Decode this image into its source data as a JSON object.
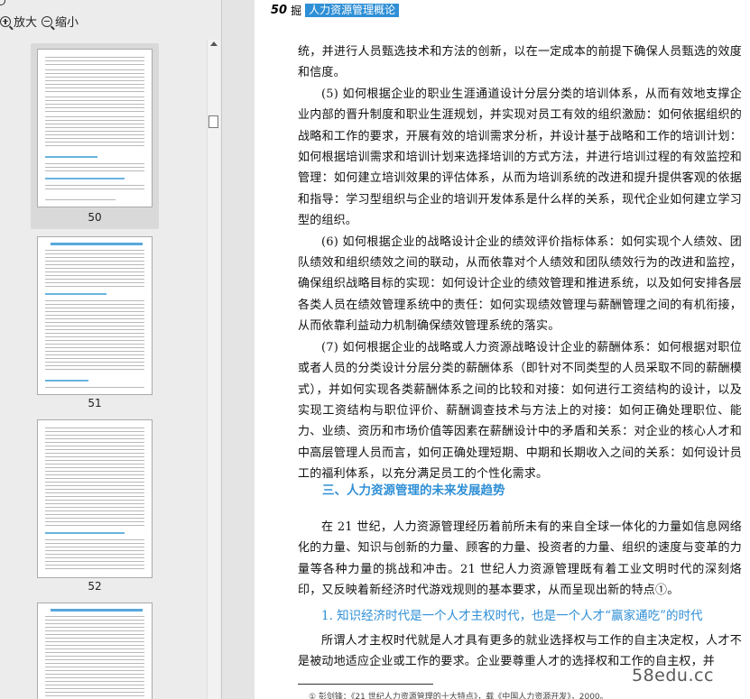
{
  "toolbar": {
    "zoom_in_label": "放大",
    "zoom_out_label": "缩小"
  },
  "thumbnails": [
    {
      "page_number": "50",
      "active": true
    },
    {
      "page_number": "51",
      "active": false
    },
    {
      "page_number": "52",
      "active": false
    }
  ],
  "page": {
    "page_number": "50",
    "header_mark": "掘",
    "header_title": "人力资源管理概论",
    "paragraphs": [
      "统，并进行人员甄选技术和方法的创新，以在一定成本的前提下确保人员甄选的效度和信度。",
      "(5) 如何根据企业的职业生涯通道设计分层分类的培训体系，从而有效地支撑企业内部的晋升制度和职业生涯规划，并实现对员工有效的组织激励：如何依据组织的战略和工作的要求，开展有效的培训需求分析，并设计基于战略和工作的培训计划：如何根据培训需求和培训计划来选择培训的方式方法，并进行培训过程的有效监控和管理：如何建立培训效果的评估体系，从而为培训系统的改进和提升提供客观的依据和指导：学习型组织与企业的培训开发体系是什么样的关系，现代企业如何建立学习型的组织。",
      "(6) 如何根据企业的战略设计企业的绩效评价指标体系：如何实现个人绩效、团队绩效和组织绩效之间的联动，从而依靠对个人绩效和团队绩效行为的改进和监控，确保组织战略目标的实现：如何设计企业的绩效管理和推进系统，以及如何安排各层各类人员在绩效管理系统中的责任：如何实现绩效管理与薪酬管理之间的有机衔接，从而依靠利益动力机制确保绩效管理系统的落实。",
      "(7) 如何根据企业的战略或人力资源战略设计企业的薪酬体系：如何根据对职位或者人员的分类设计分层分类的薪酬体系（即针对不同类型的人员采取不同的薪酬模式），并如何实现各类薪酬体系之间的比较和对接：如何进行工资结构的设计，以及实现工资结构与职位评价、薪酬调查技术与方法上的对接：如何正确处理职位、能力、业绩、资历和市场价值等因素在薪酬设计中的矛盾和关系：对企业的核心人才和中高层管理人员而言，如何正确处理短期、中期和长期收入之间的关系：如何设计员工的福利体系，以充分满足员工的个性化需求。"
    ],
    "section_heading": "三、人力资源管理的未来发展趋势",
    "section_paragraph": "在 21 世纪，人力资源管理经历着前所未有的来自全球一体化的力量如信息网络化的力量、知识与创新的力量、顾客的力量、投资者的力量、组织的速度与变革的力量等各种力量的挑战和冲击。21 世纪人力资源管理既有着工业文明时代的深刻烙印，又反映着新经济时代游戏规则的基本要求，从而呈现出新的特点①。",
    "sub_heading": "1. 知识经济时代是一个人才主权时代，也是一个人才“赢家通吃”的时代",
    "sub_paragraph": "所谓人才主权时代就是人才具有更多的就业选择权与工作的自主决定权，人才不是被动地适应企业或工作的要求。企业要尊重人才的选择权和工作的自主权，并",
    "footnote": "① 彭剑锋：《21 世纪人力资源管理的十大特点》，载《中国人力资源开发》，2000。"
  },
  "watermark": "58edu.cc"
}
